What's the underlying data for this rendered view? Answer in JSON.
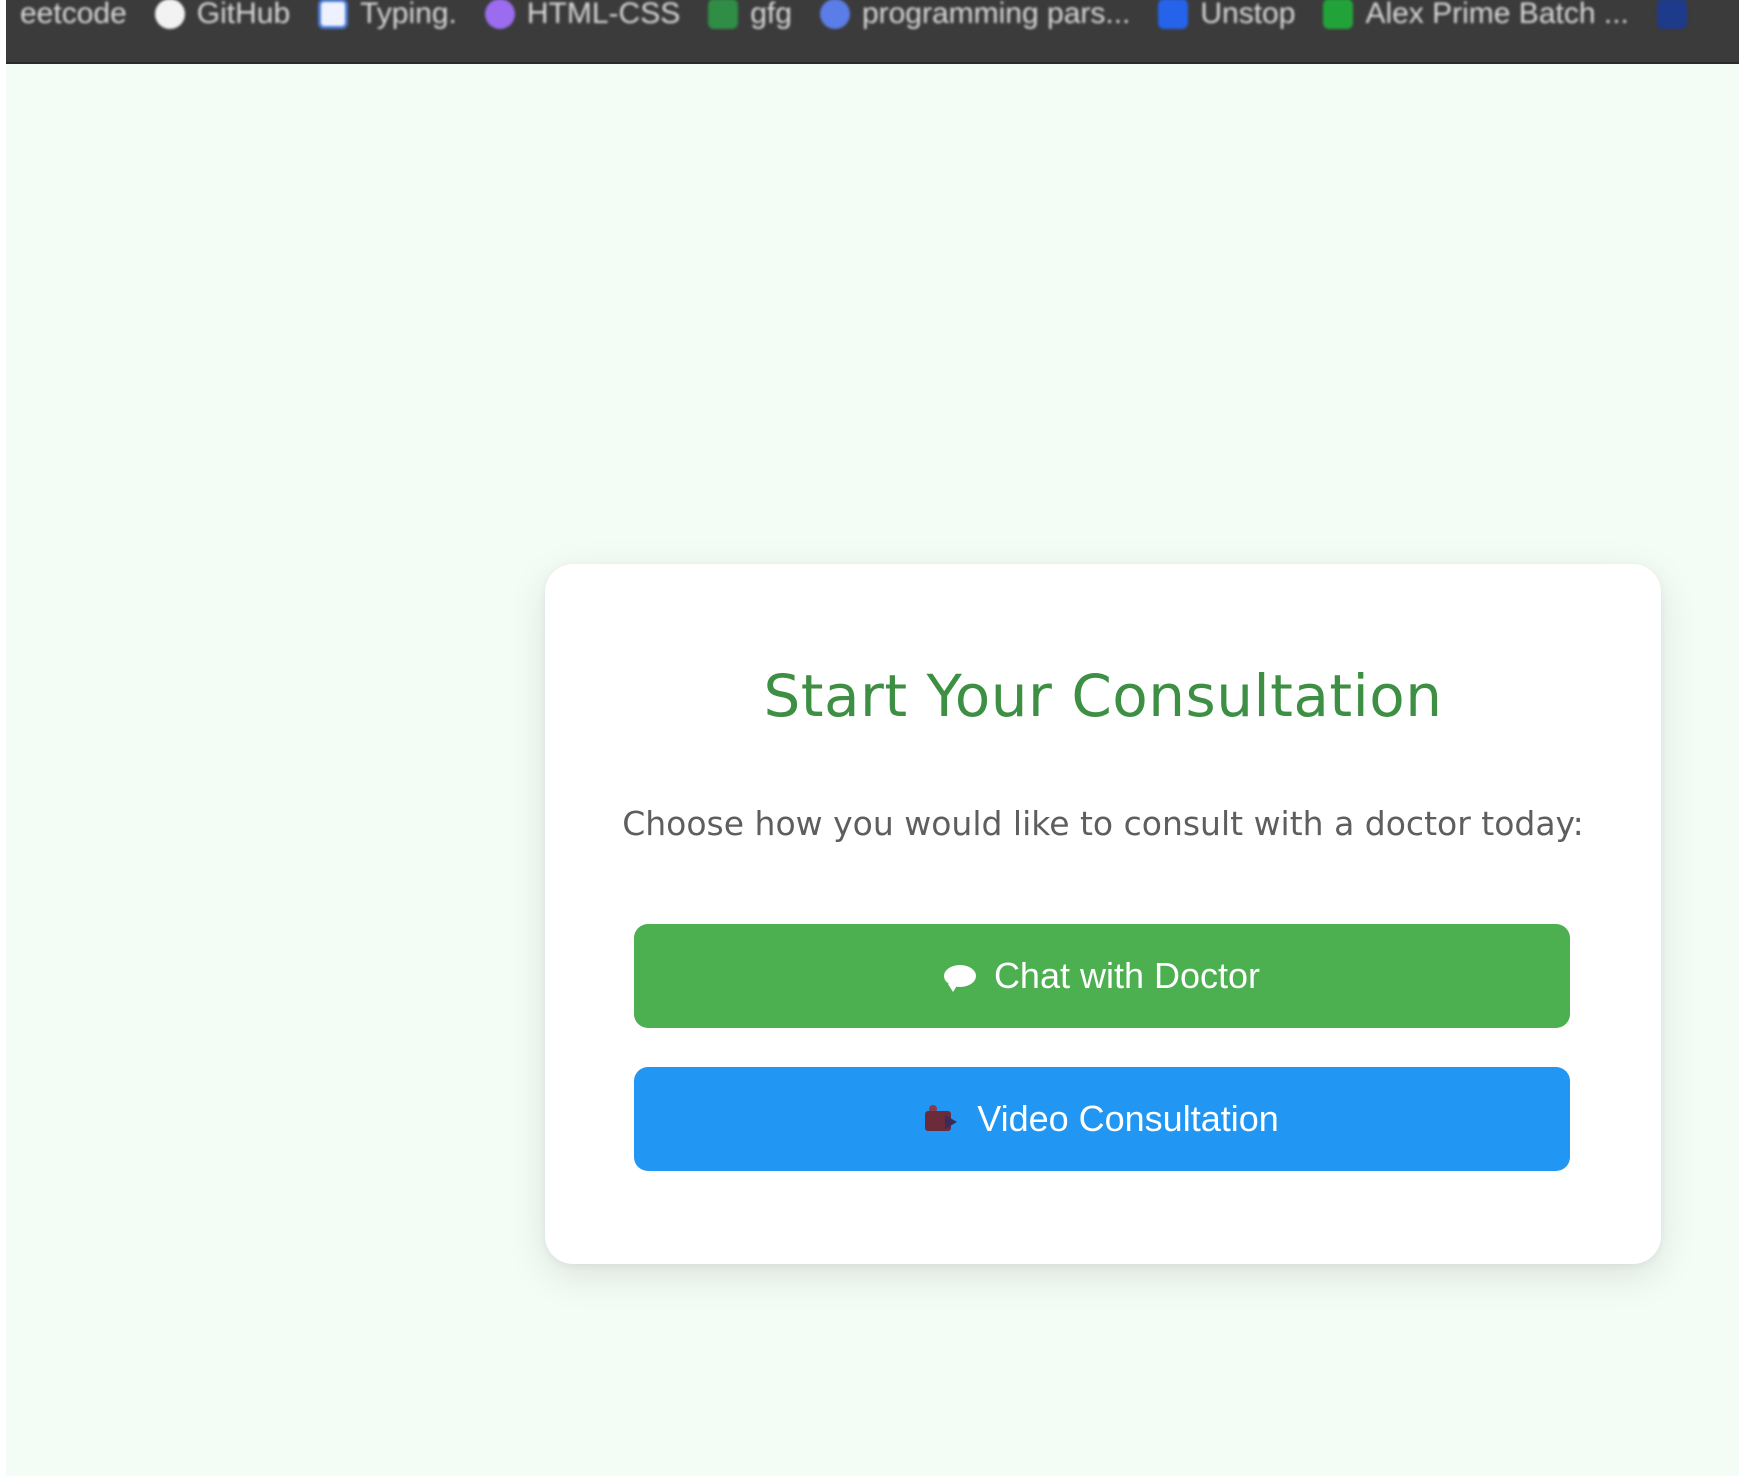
{
  "bookmarks_bar": {
    "items": [
      {
        "label": "eetcode",
        "icon": "none"
      },
      {
        "label": "GitHub",
        "icon": "github-icon"
      },
      {
        "label": "Typing.",
        "icon": "typing-icon"
      },
      {
        "label": "HTML-CSS",
        "icon": "html-css-icon"
      },
      {
        "label": "gfg",
        "icon": "gfg-icon"
      },
      {
        "label": "programming pars...",
        "icon": "programming-icon"
      },
      {
        "label": "Unstop",
        "icon": "unstop-icon"
      },
      {
        "label": "Alex Prime Batch ...",
        "icon": "alex-icon"
      }
    ]
  },
  "card": {
    "title": "Start Your Consultation",
    "subtitle": "Choose how you would like to consult with a doctor today:",
    "buttons": {
      "chat_label": "Chat with Doctor",
      "video_label": "Video Consultation"
    }
  },
  "colors": {
    "page_background": "#f4fcf6",
    "title_green": "#3d8f43",
    "chat_button": "#4caf50",
    "video_button": "#2196f3",
    "bookmarks_bar": "#3b3b3b"
  },
  "icons": {
    "chat_button_icon": "speech-bubble-icon",
    "video_button_icon": "video-camera-icon"
  }
}
